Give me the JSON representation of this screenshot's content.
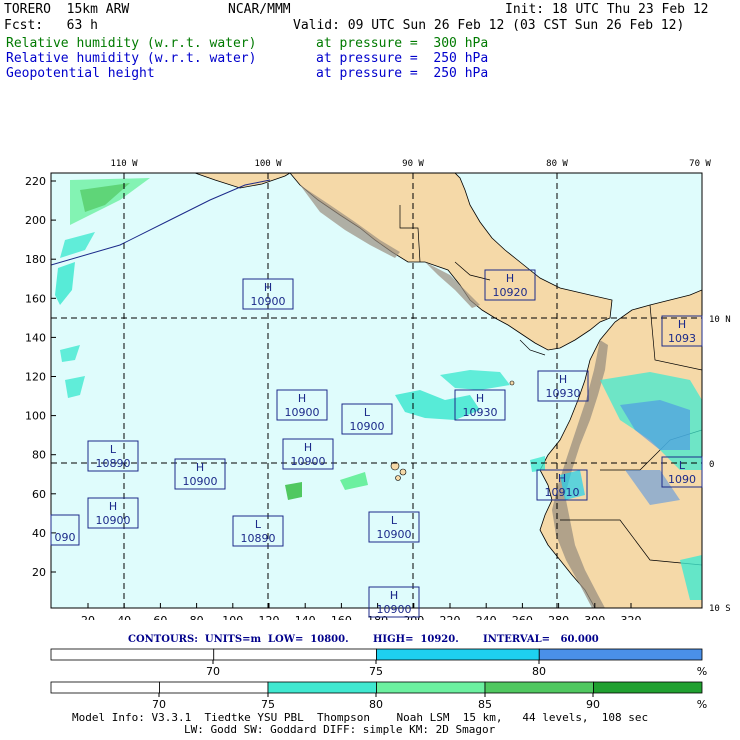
{
  "header": {
    "model": "TORERO  15km ARW",
    "org": "NCAR/MMM",
    "init": "Init: 18 UTC Thu 23 Feb 12",
    "fcst": "Fcst:   63 h",
    "valid": "Valid: 09 UTC Sun 26 Feb 12 (03 CST Sun 26 Feb 12)",
    "fields": [
      {
        "name": "Relative humidity (w.r.t. water)",
        "level": "at pressure =  300 hPa",
        "color": "#007a00"
      },
      {
        "name": "Relative humidity (w.r.t. water)",
        "level": "at pressure =  250 hPa",
        "color": "#0000cc"
      },
      {
        "name": "Geopotential height",
        "level": "at pressure =  250 hPa",
        "color": "#0000cc"
      }
    ]
  },
  "map": {
    "lon_labels": [
      "110 W",
      "100 W",
      "90 W",
      "80 W",
      "70 W"
    ],
    "lat_labels": [
      "10 N",
      "0",
      "10 S"
    ],
    "x_ticks": [
      "20",
      "40",
      "60",
      "80",
      "100",
      "120",
      "140",
      "160",
      "180",
      "200",
      "220",
      "240",
      "260",
      "280",
      "300",
      "320"
    ],
    "y_ticks": [
      "20",
      "40",
      "60",
      "80",
      "100",
      "120",
      "140",
      "160",
      "180",
      "200",
      "220"
    ],
    "colors": {
      "ocean": "#dffcfc",
      "land": "#f5d9a8",
      "mountain": "#9a8f80",
      "grid": "#000000",
      "contour": "#1c2a8a"
    },
    "centers": [
      {
        "type": "H",
        "value": "10900"
      },
      {
        "type": "H",
        "value": "10920"
      },
      {
        "type": "H",
        "value": "1093"
      },
      {
        "type": "H",
        "value": "10930"
      },
      {
        "type": "H",
        "value": "10900"
      },
      {
        "type": "L",
        "value": "10900"
      },
      {
        "type": "H",
        "value": "10930"
      },
      {
        "type": "L",
        "value": "10890"
      },
      {
        "type": "H",
        "value": "10900"
      },
      {
        "type": "H",
        "value": "10900"
      },
      {
        "type": "H",
        "value": "10910"
      },
      {
        "type": "L",
        "value": "1090"
      },
      {
        "type": "H",
        "value": "10900"
      },
      {
        "type": "L",
        "value": "10890"
      },
      {
        "type": "L",
        "value": "10900"
      },
      {
        "type": "H",
        "value": "10900"
      },
      {
        "type": "",
        "value": "090"
      },
      {
        "type": "H",
        "value": ""
      }
    ]
  },
  "contours_line": "CONTOURS:  UNITS=m  LOW=  10800.       HIGH=  10920.       INTERVAL=   60.000",
  "colorbar1": {
    "labels": [
      "70",
      "75",
      "80",
      "%"
    ],
    "segments": [
      {
        "color": "#ffffff"
      },
      {
        "color": "#ffffff"
      },
      {
        "color": "#1ed0f0"
      },
      {
        "color": "#4a90e8"
      }
    ]
  },
  "colorbar2": {
    "labels": [
      "70",
      "75",
      "80",
      "85",
      "90",
      "%"
    ],
    "segments": [
      {
        "color": "#ffffff"
      },
      {
        "color": "#ffffff"
      },
      {
        "color": "#40e8d0"
      },
      {
        "color": "#6cf0a0"
      },
      {
        "color": "#50c860"
      },
      {
        "color": "#20a030"
      }
    ]
  },
  "model_info": {
    "line1": "Model Info: V3.3.1  Tiedtke YSU PBL  Thompson    Noah LSM  15 km,   44 levels,  108 sec",
    "line2": "LW: Godd SW: Goddard DIFF: simple KM: 2D Smagor"
  }
}
